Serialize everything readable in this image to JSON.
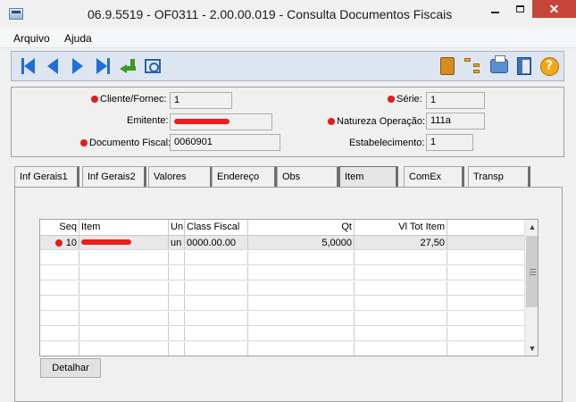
{
  "window": {
    "title": "06.9.5519 - OF0311 - 2.00.00.019 - Consulta Documentos Fiscais",
    "minimize_icon": "minimize-icon",
    "maximize_icon": "maximize-icon",
    "close_glyph": "✕"
  },
  "menu": [
    "Arquivo",
    "Ajuda"
  ],
  "toolbar": {
    "left_icons": [
      "first-record-icon",
      "previous-record-icon",
      "next-record-icon",
      "last-record-icon",
      "enter-icon",
      "zoom-icon"
    ],
    "right_icons": [
      "book-icon",
      "tree-icon",
      "print-icon",
      "exit-door-icon",
      "help-icon"
    ],
    "help_glyph": "?"
  },
  "header": {
    "cliente_label": "Cliente/Fornec:",
    "cliente_value": "1",
    "emitente_label": "Emitente:",
    "documento_label": "Documento Fiscal:",
    "documento_value": "0060901",
    "serie_label": "Série:",
    "serie_value": "1",
    "natureza_label": "Natureza Operação:",
    "natureza_value": "111a",
    "estabelecimento_label": "Estabelecimento:",
    "estabelecimento_value": "1",
    "required_color": "#e41b1b"
  },
  "tabs": [
    "Inf Gerais1",
    "Inf Gerais2",
    "Valores",
    "Endereço",
    "Obs",
    "Item",
    "ComEx",
    "Transp"
  ],
  "active_tab": "Item",
  "grid": {
    "columns": [
      "Seq",
      "Item",
      "Un",
      "Class Fiscal",
      "Qt",
      "Vl Tot Item"
    ],
    "rows": [
      {
        "seq": "10",
        "item": "",
        "un": "un",
        "class_fiscal": "0000.00.00",
        "qt": "5,0000",
        "vl_tot_item": "27,50"
      }
    ]
  },
  "detalhar_label": "Detalhar"
}
